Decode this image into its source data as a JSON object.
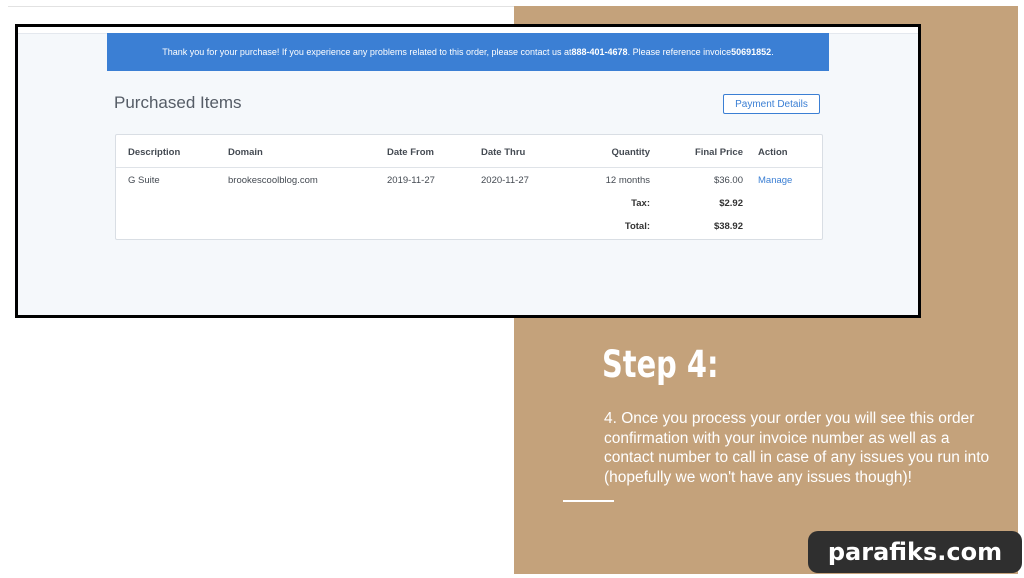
{
  "banner": {
    "prefix": "Thank you for your purchase! If you experience any problems related to this order, please contact us at ",
    "phone": "888-401-4678",
    "middle": ". Please reference invoice ",
    "invoice": "50691852",
    "suffix": "."
  },
  "page_title": "Purchased Items",
  "payment_button_label": "Payment Details",
  "table": {
    "headers": {
      "description": "Description",
      "domain": "Domain",
      "date_from": "Date From",
      "date_thru": "Date Thru",
      "quantity": "Quantity",
      "final_price": "Final Price",
      "action": "Action"
    },
    "row": {
      "description": "G Suite",
      "domain": "brookescoolblog.com",
      "date_from": "2019-11-27",
      "date_thru": "2020-11-27",
      "quantity": "12 months",
      "final_price": "$36.00",
      "action": "Manage"
    },
    "tax_label": "Tax:",
    "tax_value": "$2.92",
    "total_label": "Total:",
    "total_value": "$38.92"
  },
  "step": {
    "title": "Step 4:",
    "description": "4. Once you process your order you will see this order confirmation with your invoice number as well as a contact number to call in case of any issues you run into (hopefully we won't have any issues though)!"
  },
  "watermark": "parafiks.com",
  "colors": {
    "banner_blue": "#3b7fd4",
    "slide_tan": "#c4a27b",
    "watermark_bg": "#2f2f2f"
  }
}
